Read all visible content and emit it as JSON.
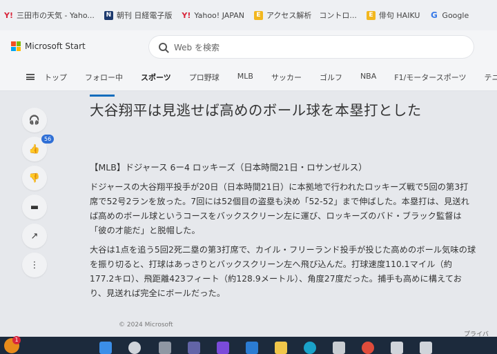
{
  "bookmarks": [
    {
      "icon": "yahoo-icon",
      "label": "三田市の天気 - Yaho..."
    },
    {
      "icon": "nikkei-icon",
      "label": "朝刊 日経電子版"
    },
    {
      "icon": "yahoo-icon",
      "label": "Yahoo! JAPAN"
    },
    {
      "icon": "e-icon",
      "label": "アクセス解析　コントロ..."
    },
    {
      "icon": "e-icon",
      "label": "俳句 HAIKU"
    },
    {
      "icon": "google-icon",
      "label": "Google"
    }
  ],
  "header": {
    "brand": "Microsoft Start",
    "search_placeholder": "Web を検索"
  },
  "nav": {
    "items": [
      "トップ",
      "フォロー中",
      "スポーツ",
      "プロ野球",
      "MLB",
      "サッカー",
      "ゴルフ",
      "NBA",
      "F1/モータースポーツ",
      "テニス"
    ],
    "active": "スポーツ"
  },
  "rail": {
    "like_count": "56"
  },
  "article": {
    "title": "大谷翔平は見逃せば高めのボール球を本塁打とした",
    "subhead": "【MLB】ドジャース 6ー4 ロッキーズ（日本時間21日・ロサンゼルス）",
    "paragraphs": [
      "ドジャースの大谷翔平投手が20日（日本時間21日）に本拠地で行われたロッキーズ戦で5回の第3打席で52号2ランを放った。7回には52個目の盗塁も決め「52-52」まで伸ばした。本塁打は、見送れば高めのボール球というコースをバックスクリーン左に運び、ロッキーズのバド・ブラック監督は「彼の才能だ」と脱帽した。",
      "大谷は1点を追う5回2死二塁の第3打席で、カイル・フリーランド投手が投じた高めのボール気味の球を振り切ると、打球はあっさりとバックスクリーン左へ飛び込んだ。打球速度110.1マイル（約177.2キロ）、飛距離423フィート（約128.9メートル）、角度27度だった。捕手も高めに構えており、見送れば完全にボールだった。"
    ]
  },
  "footer": {
    "copyright": "© 2024 Microsoft",
    "privacy": "プライバ"
  },
  "taskbar": {
    "notify_count": "1"
  }
}
